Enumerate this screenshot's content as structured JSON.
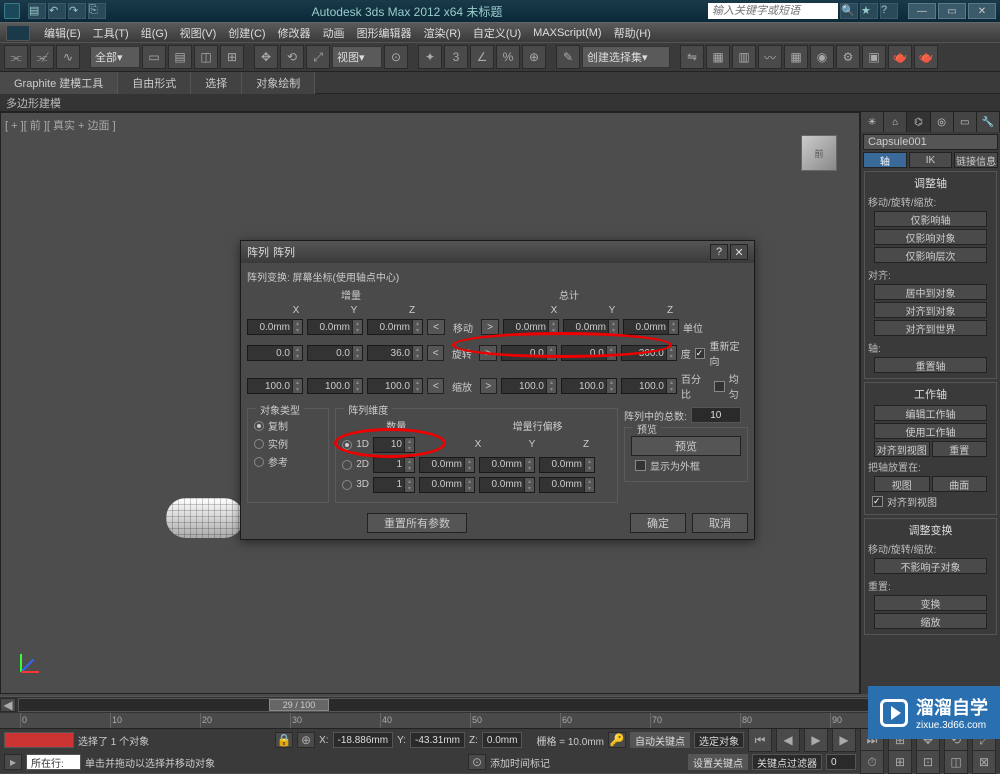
{
  "titlebar": {
    "text": "Autodesk 3ds Max 2012 x64   未标题",
    "search_placeholder": "输入关键字或短语"
  },
  "menu": [
    "编辑(E)",
    "工具(T)",
    "组(G)",
    "视图(V)",
    "创建(C)",
    "修改器",
    "动画",
    "图形编辑器",
    "渲染(R)",
    "自定义(U)",
    "MAXScript(M)",
    "帮助(H)"
  ],
  "toolbar": {
    "combo_all": "全部",
    "combo_view": "视图",
    "combo_create_sel": "创建选择集"
  },
  "subtabs": [
    "Graphite 建模工具",
    "自由形式",
    "选择",
    "对象绘制"
  ],
  "polybar": "多边形建模",
  "viewport": {
    "label": "[ + ][ 前 ][ 真实 + 边面 ]",
    "cube": "前"
  },
  "right_panel": {
    "obj_name": "Capsule001",
    "tab_axis": "轴",
    "tab_ik": "IK",
    "tab_link": "链接信息",
    "sec_adjust_axis": "调整轴",
    "lbl_move_rot_scale": "移动/旋转/缩放:",
    "btn_affect_pivot": "仅影响轴",
    "btn_affect_object": "仅影响对象",
    "btn_affect_hier": "仅影响层次",
    "lbl_align": "对齐:",
    "btn_center_obj": "居中到对象",
    "btn_align_obj": "对齐到对象",
    "btn_align_world": "对齐到世界",
    "lbl_axis2": "轴:",
    "btn_reset_axis": "重置轴",
    "sec_work_axis": "工作轴",
    "btn_edit_wa": "编辑工作轴",
    "btn_use_wa": "使用工作轴",
    "btn_align_view": "对齐到视图",
    "btn_reset": "重置",
    "lbl_place_axis": "把轴放置在:",
    "btn_viewbtn": "视图",
    "btn_curve": "曲面",
    "chk_align_view": "对齐到视图",
    "sec_adjust_xform": "调整变换",
    "lbl_move_rot_scale2": "移动/旋转/缩放:",
    "btn_no_affect_child": "不影响子对象",
    "lbl_reset2": "重置:",
    "btn_xform": "变换",
    "btn_scale": "缩放"
  },
  "dialog": {
    "title": "阵列",
    "header": "阵列变换: 屏幕坐标(使用轴点中心)",
    "incremental": "增量",
    "total": "总计",
    "x": "X",
    "y": "Y",
    "z": "Z",
    "move": "移动",
    "rotate": "旋转",
    "scale": "缩放",
    "units": "单位",
    "degrees": "度",
    "percent": "百分比",
    "reorient": "重新定向",
    "uniform": "均匀",
    "row_move": {
      "ix": "0.0mm",
      "iy": "0.0mm",
      "iz": "0.0mm",
      "tx": "0.0mm",
      "ty": "0.0mm",
      "tz": "0.0mm"
    },
    "row_rot": {
      "ix": "0.0",
      "iy": "0.0",
      "iz": "36.0",
      "tx": "0.0",
      "ty": "0.0",
      "tz": "360.0"
    },
    "row_scale": {
      "ix": "100.0",
      "iy": "100.0",
      "iz": "100.0",
      "tx": "100.0",
      "ty": "100.0",
      "tz": "100.0"
    },
    "obj_type": "对象类型",
    "copy": "复制",
    "instance": "实例",
    "reference": "参考",
    "array_dim": "阵列维度",
    "count": "数量",
    "inc_row_offset": "增量行偏移",
    "d1": "1D",
    "d2": "2D",
    "d3": "3D",
    "d1_count": "10",
    "d2_count": "1",
    "d3_count": "1",
    "d2_x": "0.0mm",
    "d2_y": "0.0mm",
    "d2_z": "0.0mm",
    "d3_x": "0.0mm",
    "d3_y": "0.0mm",
    "d3_z": "0.0mm",
    "total_in_array": "阵列中的总数:",
    "total_count": "10",
    "preview": "预览",
    "preview_btn": "预览",
    "show_wire": "显示为外框",
    "reset_all": "重置所有参数",
    "ok": "确定",
    "cancel": "取消"
  },
  "status": {
    "slider_text": "29 / 100",
    "sel_text": "选择了 1 个对象",
    "hint": "单击并拖动以选择并移动对象",
    "add_time": "添加时间标记",
    "x_lbl": "X:",
    "x_val": "-18.886mm",
    "y_lbl": "Y:",
    "y_val": "-43.31mm",
    "z_lbl": "Z:",
    "z_val": "0.0mm",
    "grid": "栅格 = 10.0mm",
    "auto_key": "自动关键点",
    "sel_filter": "选定对象",
    "set_key": "设置关键点",
    "key_filter": "关键点过滤器",
    "location": "所在行:"
  },
  "watermark": {
    "main": "溜溜自学",
    "sub": "zixue.3d66.com"
  }
}
